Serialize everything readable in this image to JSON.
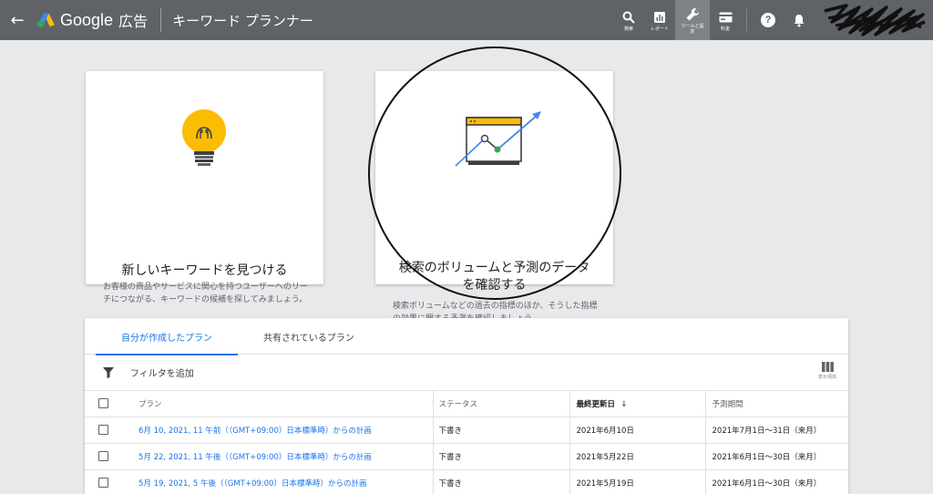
{
  "header": {
    "brand_google": "Google",
    "brand_ads": "広告",
    "page_title": "キーワード プランナー",
    "tools": [
      {
        "icon": "search-icon",
        "label": "検索"
      },
      {
        "icon": "reports-icon",
        "label": "レポート"
      },
      {
        "icon": "wrench-icon",
        "label": "ツールと設定"
      },
      {
        "icon": "billing-icon",
        "label": "料金"
      }
    ]
  },
  "cards": {
    "discover": {
      "title": "新しいキーワードを見つける",
      "desc": "お客様の商品やサービスに関心を持つユーザーへのリーチにつながる、キーワードの候補を探してみましょう。"
    },
    "forecast": {
      "title_line1": "検索のボリュームと予測のデータ",
      "title_line2": "を確認する",
      "desc": "検索ボリュームなどの過去の指標のほか、そうした指標の効果に関する予測を確認しましょう"
    }
  },
  "plans": {
    "tabs": [
      "自分が作成したプラン",
      "共有されているプラン"
    ],
    "filter_label": "フィルタを追加",
    "columns_label": "表示項目",
    "columns": [
      "プラン",
      "ステータス",
      "最終更新日",
      "予測期間"
    ],
    "rows": [
      {
        "plan": "6月 10, 2021, 11 午前（（GMT+09:00）日本標準時）からの計画",
        "status": "下書き",
        "updated": "2021年6月10日",
        "period": "2021年7月1日～31日（来月）"
      },
      {
        "plan": "5月 22, 2021, 11 午後（（GMT+09:00）日本標準時）からの計画",
        "status": "下書き",
        "updated": "2021年5月22日",
        "period": "2021年6月1日～30日（来月）"
      },
      {
        "plan": "5月 19, 2021, 5 午後（（GMT+09:00）日本標準時）からの計画",
        "status": "下書き",
        "updated": "2021年5月19日",
        "period": "2021年6月1日～30日（来月）"
      }
    ]
  },
  "colors": {
    "topbar": "#5f6368",
    "accent": "#1a73e8",
    "bulb": "#fbbc04",
    "chart_green": "#34a853"
  }
}
